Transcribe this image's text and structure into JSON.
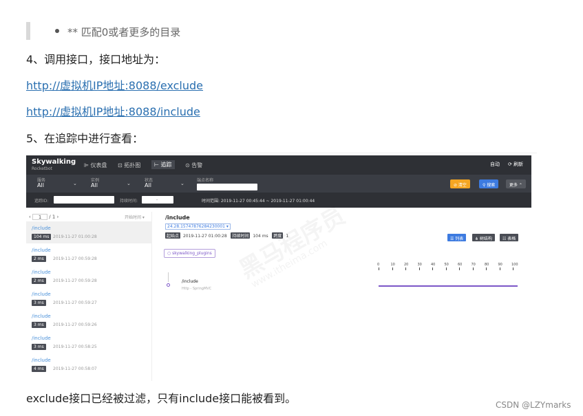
{
  "bullet_text": "** 匹配0或者更多的目录",
  "step4": "4、调用接口，接口地址为：",
  "links": [
    "http://虚拟机IP地址:8088/exclude",
    "http://虚拟机IP地址:8088/include"
  ],
  "step5": "5、在追踪中进行查看：",
  "conclusion": "exclude接口已经被过滤，只有include接口能被看到。",
  "watermark_credit": "CSDN @LZYmarks",
  "skywalking": {
    "logo": "Skywalking",
    "logo_sub": "Rocketbot",
    "nav": {
      "dashboard": "⊫ 仪表盘",
      "topology": "⊡ 拓扑图",
      "trace": "⊢ 追踪",
      "alarm": "⊙ 告警"
    },
    "auto": "自动",
    "refresh": "⟳ 刷新",
    "filters": {
      "service_label": "服务",
      "service_value": "All",
      "instance_label": "实例",
      "instance_value": "All",
      "state_label": "状态",
      "state_value": "All",
      "endpoint_label": "端点名称"
    },
    "buttons": {
      "reset": "⊘ 清空",
      "search": "⚲ 搜索",
      "more": "更多 ⌃"
    },
    "trace_id_label": "追踪ID:",
    "duration_label": "持续时间:",
    "duration_sep": "-",
    "time_range": "时间范围:  2019-11-27 00:45:44 ~ 2019-11-27 01:00:44",
    "pager_prev": "‹",
    "pager_page": "1",
    "pager_total": "/ 1  ›",
    "sort_label": "开始时间 ▾",
    "traces": [
      {
        "name": "/include",
        "duration": "104 ms",
        "time": "2019-11-27 01:00:28"
      },
      {
        "name": "/include",
        "duration": "2 ms",
        "time": "2019-11-27 00:59:28"
      },
      {
        "name": "/include",
        "duration": "2 ms",
        "time": "2019-11-27 00:59:28"
      },
      {
        "name": "/include",
        "duration": "3 ms",
        "time": "2019-11-27 00:59:27"
      },
      {
        "name": "/include",
        "duration": "3 ms",
        "time": "2019-11-27 00:59:26"
      },
      {
        "name": "/include",
        "duration": "3 ms",
        "time": "2019-11-27 00:58:25"
      },
      {
        "name": "/include",
        "duration": "4 ms",
        "time": "2019-11-27 00:58:07"
      }
    ],
    "detail": {
      "title": "/include",
      "trace_select": "24.28.15747876284230001 ▾",
      "start_tag": "起始点",
      "start_value": "2019-11-27 01:00:28",
      "duration_tag": "持续时间",
      "duration_value": "104 ms",
      "span_tag": "跨度",
      "span_value": "1",
      "view_list": "☰ 列表",
      "view_tree": "⋔ 树结构",
      "view_table": "☷ 表格",
      "plugin": "○ skywalking_plugins",
      "axis_ticks": [
        "0",
        "10",
        "20",
        "30",
        "40",
        "50",
        "60",
        "70",
        "80",
        "90",
        "100"
      ],
      "span_name": "/include",
      "span_sub": "Http - SpringMVC"
    },
    "watermark": "黑马程序员",
    "watermark_url": "www.itheima.com"
  }
}
